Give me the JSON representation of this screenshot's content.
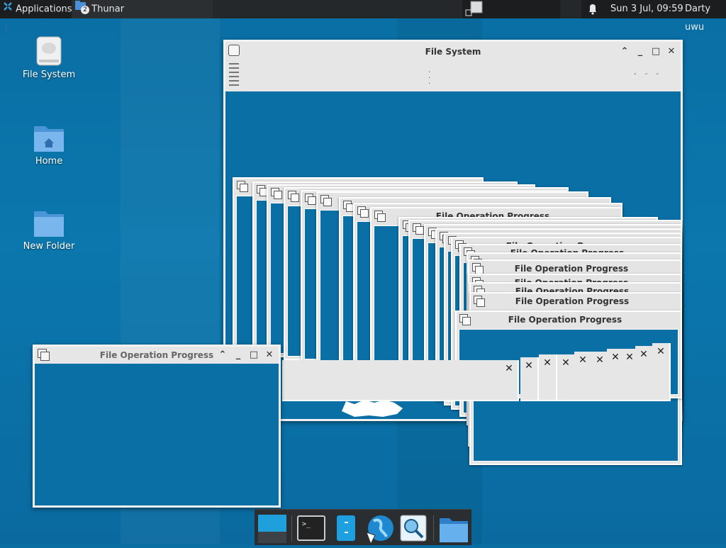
{
  "top_panel": {
    "applications_label": "Applications",
    "task_label": "Thunar",
    "task_badge": "2",
    "clock": "Sun  3 Jul, 09:59",
    "user": "Darty uwu"
  },
  "desktop_icons": {
    "filesystem": "File System",
    "home": "Home",
    "new_folder": "New Folder"
  },
  "main_window": {
    "title": "File System"
  },
  "progress_window": {
    "title": "File Operation Progress"
  },
  "ghost_title": "File Operation Progress",
  "colors": {
    "desktop": "#0a6fa4",
    "panel": "#1b1d1f",
    "titlebar": "#e6e6e6"
  },
  "icons": [
    "applications-icon",
    "thunar-icon",
    "notification-bell-icon",
    "disk-icon",
    "home-folder-icon",
    "folder-icon",
    "copy-icon",
    "close-icon",
    "maximize-icon",
    "minimize-icon",
    "shade-icon",
    "terminal-icon",
    "browser-icon",
    "search-icon"
  ]
}
